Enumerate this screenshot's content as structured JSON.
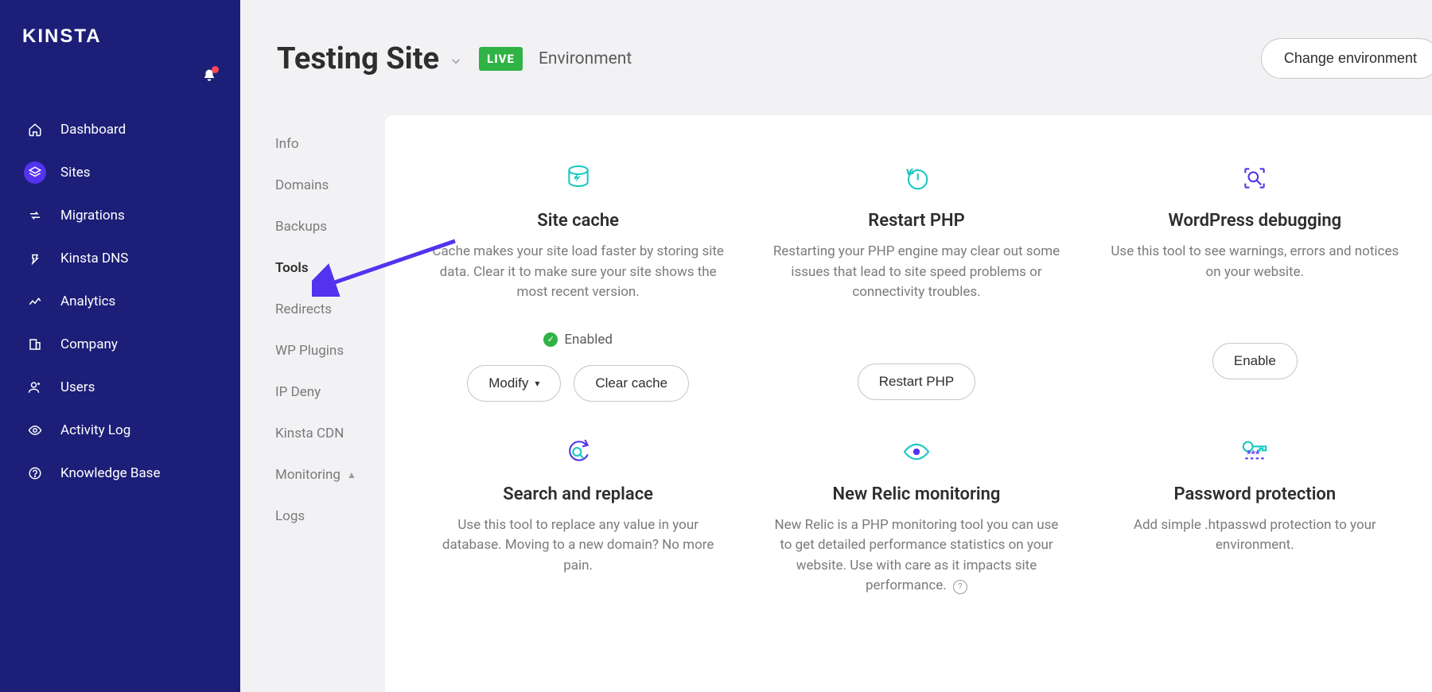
{
  "brand": "KINSTA",
  "notifications_unread": true,
  "nav": {
    "items": [
      {
        "label": "Dashboard",
        "name": "dashboard"
      },
      {
        "label": "Sites",
        "name": "sites",
        "active": true
      },
      {
        "label": "Migrations",
        "name": "migrations"
      },
      {
        "label": "Kinsta DNS",
        "name": "kinsta-dns"
      },
      {
        "label": "Analytics",
        "name": "analytics"
      },
      {
        "label": "Company",
        "name": "company"
      },
      {
        "label": "Users",
        "name": "users"
      },
      {
        "label": "Activity Log",
        "name": "activity-log"
      },
      {
        "label": "Knowledge Base",
        "name": "knowledge-base"
      }
    ]
  },
  "header": {
    "site_title": "Testing Site",
    "live_badge": "LIVE",
    "env_label": "Environment",
    "change_env": "Change environment"
  },
  "sitenav": {
    "items": [
      {
        "label": "Info"
      },
      {
        "label": "Domains"
      },
      {
        "label": "Backups"
      },
      {
        "label": "Tools",
        "active": true
      },
      {
        "label": "Redirects"
      },
      {
        "label": "WP Plugins"
      },
      {
        "label": "IP Deny"
      },
      {
        "label": "Kinsta CDN"
      },
      {
        "label": "Monitoring",
        "warn": true
      },
      {
        "label": "Logs"
      }
    ]
  },
  "tools": {
    "site_cache": {
      "title": "Site cache",
      "desc": "Cache makes your site load faster by storing site data. Clear it to make sure your site shows the most recent version.",
      "status": "Enabled",
      "modify": "Modify",
      "clear": "Clear cache"
    },
    "restart_php": {
      "title": "Restart PHP",
      "desc": "Restarting your PHP engine may clear out some issues that lead to site speed problems or connectivity troubles.",
      "button": "Restart PHP"
    },
    "wp_debug": {
      "title": "WordPress debugging",
      "desc": "Use this tool to see warnings, errors and notices on your website.",
      "button": "Enable"
    },
    "search_replace": {
      "title": "Search and replace",
      "desc": "Use this tool to replace any value in your database. Moving to a new domain? No more pain."
    },
    "new_relic": {
      "title": "New Relic monitoring",
      "desc": "New Relic is a PHP monitoring tool you can use to get detailed performance statistics on your website. Use with care as it impacts site performance."
    },
    "password_protection": {
      "title": "Password protection",
      "desc": "Add simple .htpasswd protection to your environment."
    }
  }
}
